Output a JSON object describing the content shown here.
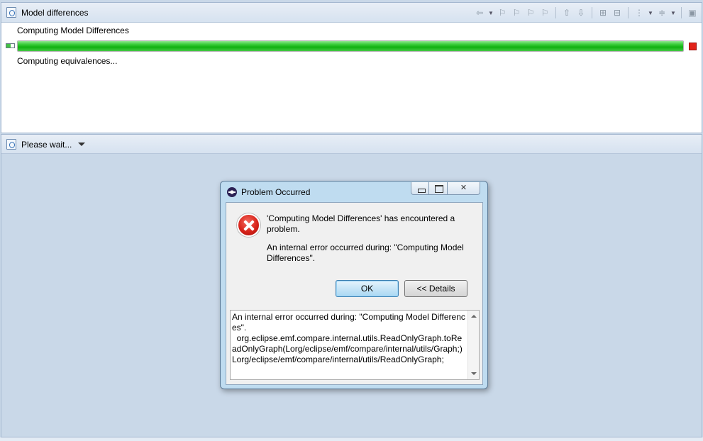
{
  "top_view": {
    "title": "Model differences",
    "icon": "compare-view-icon",
    "toolbar": [
      "back-arrow-icon",
      "dropdown-arrow",
      "filter-icon-1",
      "filter-icon-2",
      "filter-icon-3",
      "filter-icon-4",
      "merge-icon-1",
      "merge-icon-2",
      "expand-all-icon",
      "collapse-all-icon",
      "group-icon",
      "dropdown-arrow",
      "filter-menu-icon",
      "dropdown-arrow",
      "save-icon"
    ],
    "task_name": "Computing Model Differences",
    "progress": 1.0,
    "subtask": "Computing equivalences..."
  },
  "bottom_view": {
    "title": "Please wait..."
  },
  "dialog": {
    "title": "Problem Occurred",
    "message1": "'Computing Model Differences' has encountered a problem.",
    "message2": "An internal error occurred during: \"Computing Model Differences\".",
    "ok_label": "OK",
    "details_label": "<< Details",
    "details_text": "An internal error occurred during: \"Computing Model Differences\".\n  org.eclipse.emf.compare.internal.utils.ReadOnlyGraph.toReadOnlyGraph(Lorg/eclipse/emf/compare/internal/utils/Graph;)Lorg/eclipse/emf/compare/internal/utils/ReadOnlyGraph;"
  },
  "colors": {
    "progress_green": "#10b110",
    "stop_red": "#e2231a",
    "error_red": "#d8231a",
    "workbench_bg": "#c9d8e8"
  }
}
